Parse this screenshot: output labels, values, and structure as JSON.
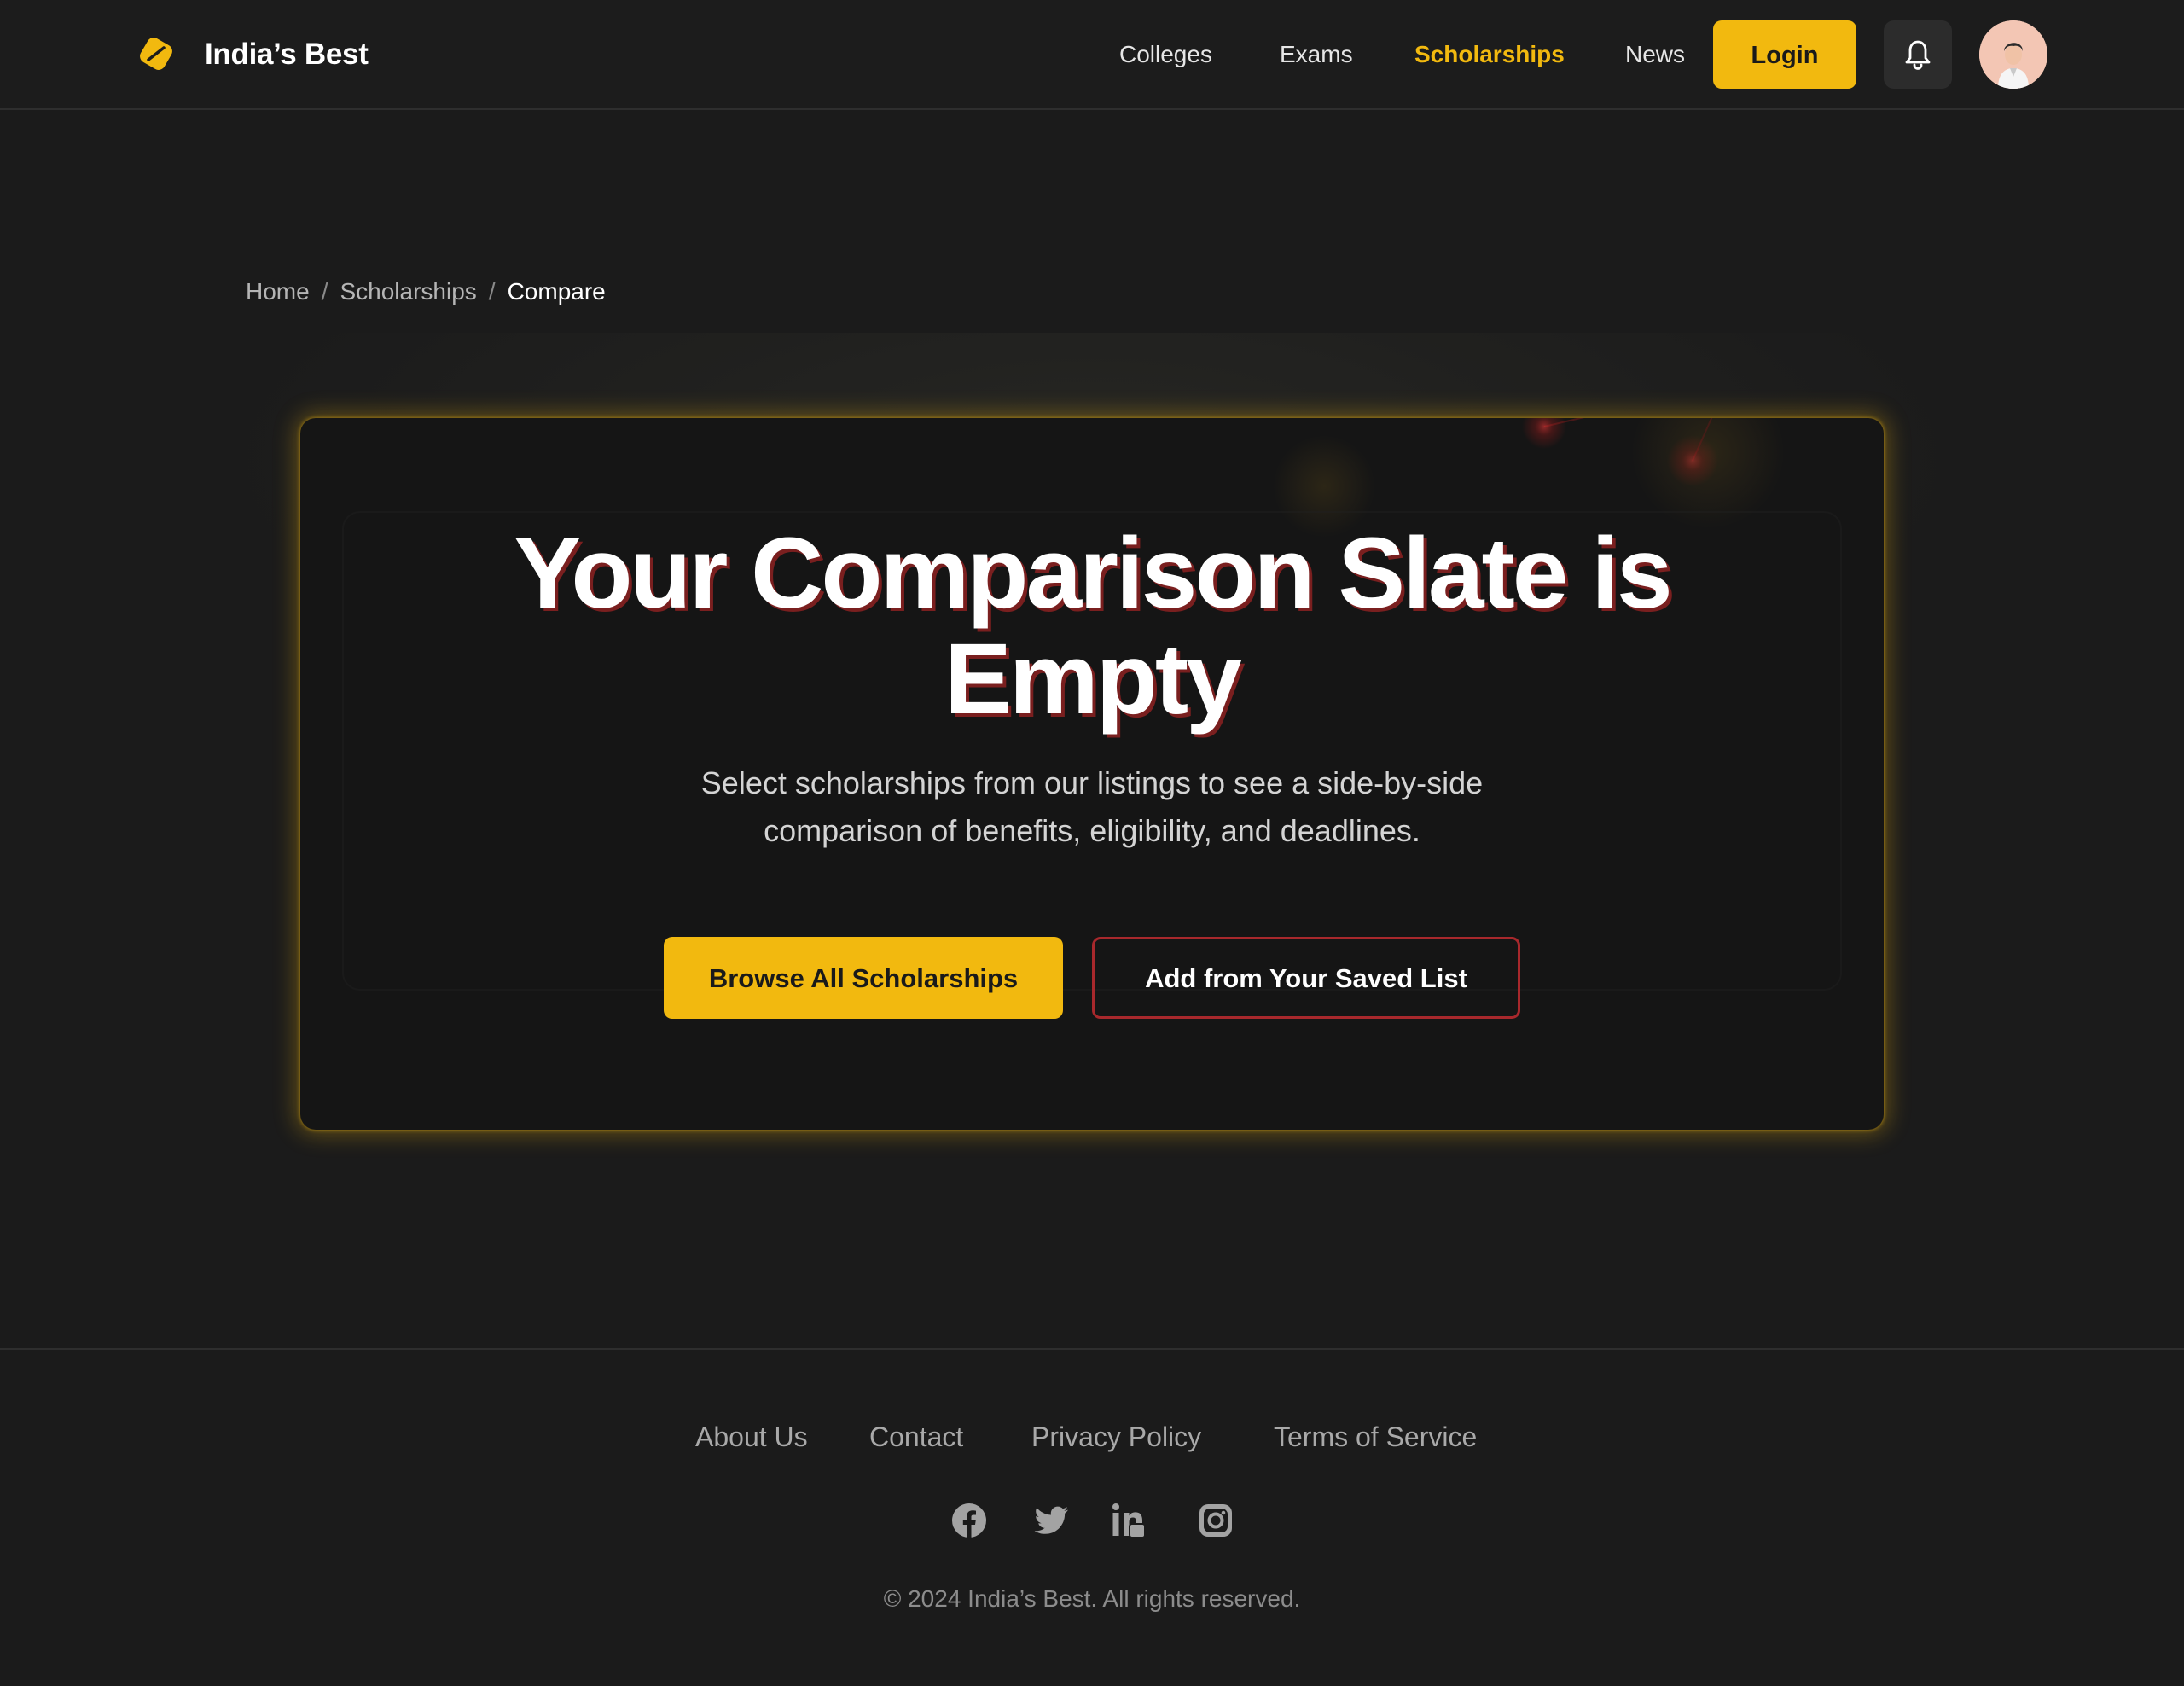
{
  "header": {
    "brand": "India’s Best",
    "nav": [
      {
        "label": "Colleges"
      },
      {
        "label": "Exams"
      },
      {
        "label": "Scholarships",
        "active": true
      },
      {
        "label": "News"
      }
    ],
    "login_label": "Login",
    "accent_color": "#f2b90f",
    "icons": [
      "logo-icon",
      "bell-icon",
      "avatar"
    ]
  },
  "breadcrumb": {
    "items": [
      "Home",
      "Scholarships",
      "Compare"
    ],
    "separator": "/"
  },
  "hero": {
    "title_line1": "Your Comparison Slate is",
    "title_line2": "Empty",
    "subtitle_line1": "Select scholarships from our listings to see a side-by-side",
    "subtitle_line2": "comparison of benefits, eligibility, and deadlines.",
    "primary_button": "Browse All Scholarships",
    "secondary_button": "Add from Your Saved List",
    "secondary_border_color": "#a8282c"
  },
  "footer": {
    "links": [
      "About Us",
      "Contact",
      "Privacy Policy",
      "Terms of Service"
    ],
    "social": [
      "facebook-icon",
      "twitter-icon",
      "linkedin-icon",
      "instagram-icon"
    ],
    "copyright": "© 2024 India’s Best. All rights reserved."
  }
}
